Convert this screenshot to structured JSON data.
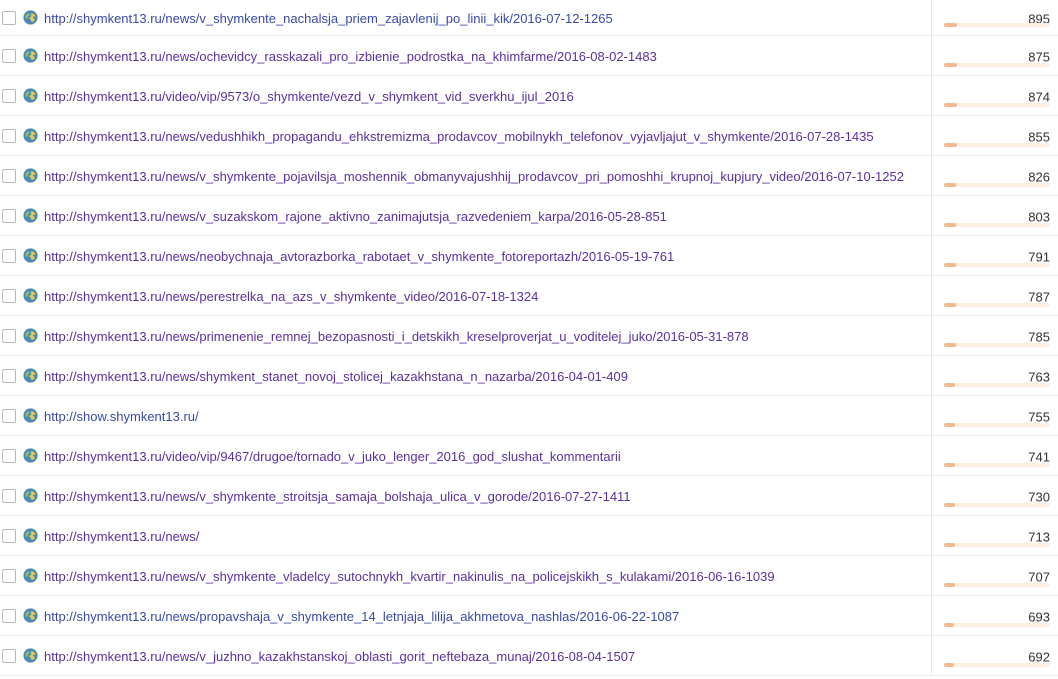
{
  "colors": {
    "link": "#3949a8",
    "link_visited": "#5b2fa0",
    "bar_fill": "#f3b990",
    "bar_track": "#fdeee2",
    "row_border": "#ececec"
  },
  "favicon_icon": "globe-icon",
  "rows": [
    {
      "url": "http://shymkent13.ru/news/v_shymkente_nachalsja_priem_zajavlenij_po_linii_kik/2016-07-12-1265",
      "value": "895",
      "fill": 0.12,
      "visited": false
    },
    {
      "url": "http://shymkent13.ru/news/ochevidcy_rasskazali_pro_izbienie_podrostka_na_khimfarme/2016-08-02-1483",
      "value": "875",
      "fill": 0.12,
      "visited": true
    },
    {
      "url": "http://shymkent13.ru/video/vip/9573/o_shymkente/vezd_v_shymkent_vid_sverkhu_ijul_2016",
      "value": "874",
      "fill": 0.12,
      "visited": true
    },
    {
      "url": "http://shymkent13.ru/news/vedushhikh_propagandu_ehkstremizma_prodavcov_mobilnykh_telefonov_vyjavljajut_v_shymkente/2016-07-28-1435",
      "value": "855",
      "fill": 0.12,
      "visited": true
    },
    {
      "url": "http://shymkent13.ru/news/v_shymkente_pojavilsja_moshennik_obmanyvajushhij_prodavcov_pri_pomoshhi_krupnoj_kupjury_video/2016-07-10-1252",
      "value": "826",
      "fill": 0.11,
      "visited": true
    },
    {
      "url": "http://shymkent13.ru/news/v_suzakskom_rajone_aktivno_zanimajutsja_razvedeniem_karpa/2016-05-28-851",
      "value": "803",
      "fill": 0.11,
      "visited": true
    },
    {
      "url": "http://shymkent13.ru/news/neobychnaja_avtorazborka_rabotaet_v_shymkente_fotoreportazh/2016-05-19-761",
      "value": "791",
      "fill": 0.11,
      "visited": true
    },
    {
      "url": "http://shymkent13.ru/news/perestrelka_na_azs_v_shymkente_video/2016-07-18-1324",
      "value": "787",
      "fill": 0.11,
      "visited": true
    },
    {
      "url": "http://shymkent13.ru/news/primenenie_remnej_bezopasnosti_i_detskikh_kreselproverjat_u_voditelej_juko/2016-05-31-878",
      "value": "785",
      "fill": 0.11,
      "visited": true
    },
    {
      "url": "http://shymkent13.ru/news/shymkent_stanet_novoj_stolicej_kazakhstana_n_nazarba/2016-04-01-409",
      "value": "763",
      "fill": 0.1,
      "visited": true
    },
    {
      "url": "http://show.shymkent13.ru/",
      "value": "755",
      "fill": 0.1,
      "visited": false
    },
    {
      "url": "http://shymkent13.ru/video/vip/9467/drugoe/tornado_v_juko_lenger_2016_god_slushat_kommentarii",
      "value": "741",
      "fill": 0.1,
      "visited": true
    },
    {
      "url": "http://shymkent13.ru/news/v_shymkente_stroitsja_samaja_bolshaja_ulica_v_gorode/2016-07-27-1411",
      "value": "730",
      "fill": 0.1,
      "visited": true
    },
    {
      "url": "http://shymkent13.ru/news/",
      "value": "713",
      "fill": 0.1,
      "visited": true
    },
    {
      "url": "http://shymkent13.ru/news/v_shymkente_vladelcy_sutochnykh_kvartir_nakinulis_na_policejskikh_s_kulakami/2016-06-16-1039",
      "value": "707",
      "fill": 0.1,
      "visited": true
    },
    {
      "url": "http://shymkent13.ru/news/propavshaja_v_shymkente_14_letnjaja_lilija_akhmetova_nashlas/2016-06-22-1087",
      "value": "693",
      "fill": 0.09,
      "visited": false
    },
    {
      "url": "http://shymkent13.ru/news/v_juzhno_kazakhstanskoj_oblasti_gorit_neftebaza_munaj/2016-08-04-1507",
      "value": "692",
      "fill": 0.09,
      "visited": true
    }
  ]
}
